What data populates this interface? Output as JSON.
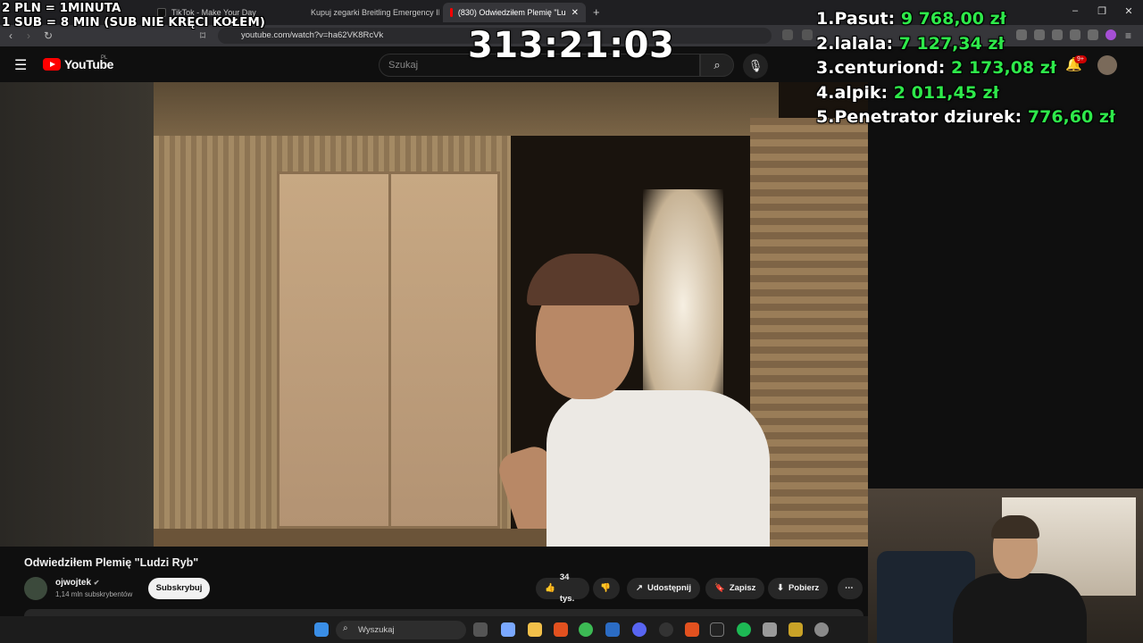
{
  "browser": {
    "tabs": [
      {
        "label": "TikTok - Make Your Day",
        "color": "#111111"
      },
      {
        "label": "Kupuj zegarki Breitling Emergency II",
        "color": "#2a2a2a"
      },
      {
        "label": "(830) Odwiedziłem Plemię \"Lu",
        "color": "#ff0000"
      }
    ],
    "url": "youtube.com/watch?v=ha62VK8RcVk"
  },
  "youtube": {
    "logo_text": "YouTube",
    "region": "PL",
    "search_placeholder": "Szukaj",
    "notifications_badge": "9+",
    "video_title": "Odwiedziłem Plemię \"Ludzi Ryb\"",
    "channel_name": "ojwojtek",
    "channel_subs": "1,14 mln subskrybentów",
    "subscribe_label": "Subskrybuj",
    "like_count": "34 tys.",
    "share_label": "Udostępnij",
    "save_label": "Zapisz",
    "download_label": "Pobierz"
  },
  "taskbar": {
    "search_placeholder": "Wyszukaj"
  },
  "overlay": {
    "rate_line1": "2 PLN = 1MINUTA",
    "rate_line2": "1 SUB = 8 MIN (SUB NIE KRĘCI KOŁEM)",
    "timer": "313:21:03",
    "leaderboard": [
      {
        "rank": "1.",
        "name": "Pasut:",
        "amount": "9 768,00 zł"
      },
      {
        "rank": "2.",
        "name": "lalala:",
        "amount": "7 127,34 zł"
      },
      {
        "rank": "3.",
        "name": "centuriond:",
        "amount": "2 173,08 zł"
      },
      {
        "rank": "4.",
        "name": "alpik:",
        "amount": "2 011,45 zł"
      },
      {
        "rank": "5.",
        "name": "Penetrator dziurek:",
        "amount": "776,60 zł"
      }
    ]
  },
  "colors": {
    "amount": "#2ee94a",
    "youtube_red": "#ff0000"
  }
}
